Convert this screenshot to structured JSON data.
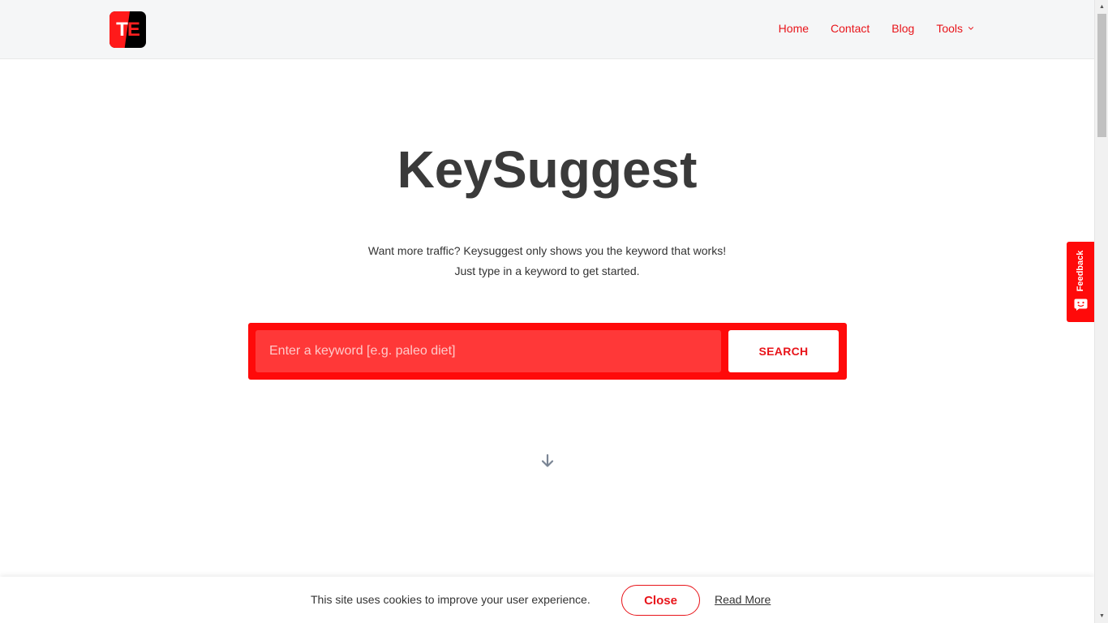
{
  "header": {
    "logo_text_t": "T",
    "logo_text_e": "E",
    "nav": {
      "home": "Home",
      "contact": "Contact",
      "blog": "Blog",
      "tools": "Tools"
    }
  },
  "hero": {
    "title": "KeySuggest",
    "subtitle_line1": "Want more traffic? Keysuggest only shows you the keyword that works!",
    "subtitle_line2": "Just type in a keyword to get started."
  },
  "search": {
    "placeholder": "Enter a keyword [e.g. paleo diet]",
    "button_label": "SEARCH"
  },
  "feedback": {
    "label": "Feedback"
  },
  "cookie": {
    "text": "This site uses cookies to improve your user experience.",
    "close_label": "Close",
    "read_more_label": "Read More"
  },
  "colors": {
    "brand_red": "#ff0a0a",
    "nav_red": "#e8141a",
    "title_gray": "#3a3a3a"
  },
  "icons": {
    "dropdown": "chevron-down-icon",
    "scroll_hint": "arrow-down-icon",
    "feedback": "chat-face-icon"
  }
}
